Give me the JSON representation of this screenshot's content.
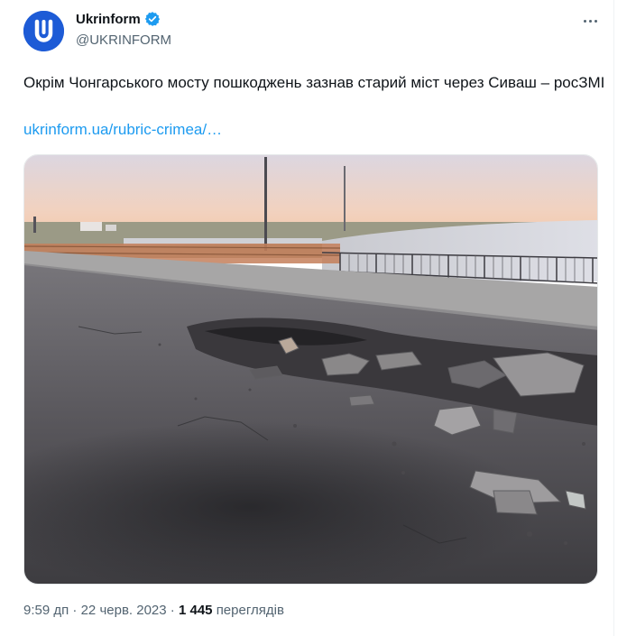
{
  "account": {
    "display_name": "Ukrinform",
    "handle": "@UKRINFORM",
    "avatar_glyph": "U",
    "brand_color": "#1d5bd6",
    "verified_color": "#1d9bf0"
  },
  "tweet": {
    "text": "Окрім Чонгарського мосту пошкоджень зазнав старий міст через Сиваш – росЗМІ",
    "link": "ukrinform.ua/rubric-crimea/…",
    "link_color": "#1d9bf0",
    "media_alt": "Damaged bridge road surface with crater and concrete debris"
  },
  "meta": {
    "time": "9:59 дп",
    "separator": "·",
    "date": "22 черв. 2023",
    "views_count": "1 445",
    "views_label": "переглядів"
  },
  "icons": {
    "verified": "verified-badge-icon",
    "more": "more-options-icon"
  }
}
